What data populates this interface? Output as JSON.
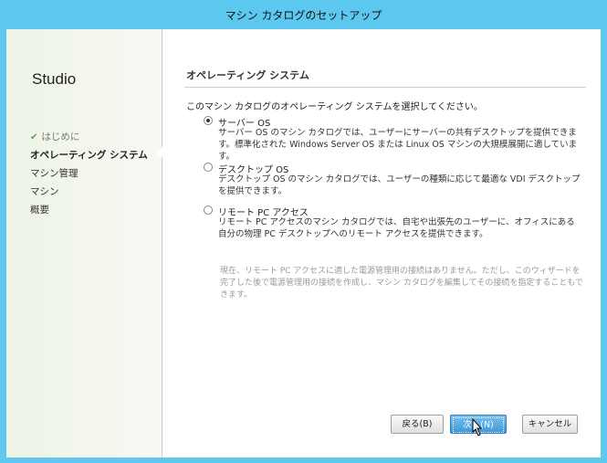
{
  "window": {
    "title": "マシン カタログのセットアップ"
  },
  "sidebar": {
    "brand": "Studio",
    "items": [
      {
        "label": "はじめに",
        "state": "done"
      },
      {
        "label": "オペレーティング システム",
        "state": "active"
      },
      {
        "label": "マシン管理",
        "state": "pending"
      },
      {
        "label": "マシン",
        "state": "pending"
      },
      {
        "label": "概要",
        "state": "pending"
      }
    ]
  },
  "main": {
    "section_title": "オペレーティング システム",
    "prompt": "このマシン カタログのオペレーティング システムを選択してください。",
    "options": [
      {
        "label": "サーバー OS",
        "selected": true,
        "description": "サーバー OS のマシン カタログでは、ユーザーにサーバーの共有デスクトップを提供できます。標準化された Windows Server OS または Linux OS マシンの大規模展開に適しています。"
      },
      {
        "label": "デスクトップ OS",
        "selected": false,
        "description": "デスクトップ OS のマシン カタログでは、ユーザーの種類に応じて最適な VDI デスクトップを提供できます。"
      },
      {
        "label": "リモート PC アクセス",
        "selected": false,
        "description": "リモート PC アクセスのマシン カタログでは、自宅や出張先のユーザーに、オフィスにある自分の物理 PC デスクトップへのリモート アクセスを提供できます。"
      }
    ],
    "note": "現在、リモート PC アクセスに適した電源管理用の接続はありません。ただし、このウィザードを完了した後で電源管理用の接続を作成し、マシン カタログを編集してその接続を指定することもできます。"
  },
  "footer": {
    "back_label": "戻る(B)",
    "next_label": "次へ(N)",
    "cancel_label": "キャンセル"
  },
  "colors": {
    "titlebar": "#5cc8ef",
    "primary_button": "#3c97d8",
    "check": "#5aa05a"
  }
}
